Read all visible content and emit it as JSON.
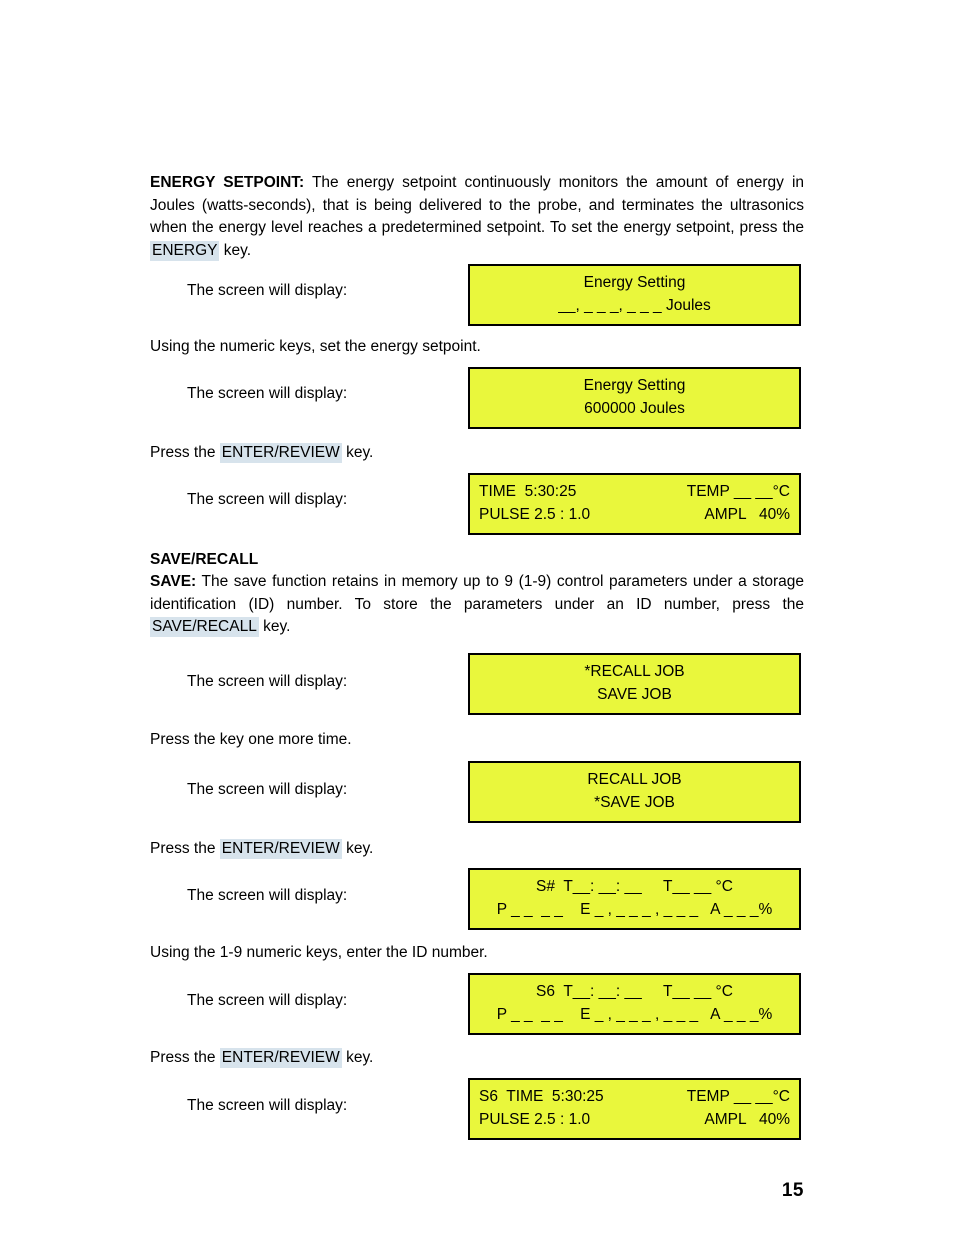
{
  "document": {
    "page_number": "15",
    "colors": {
      "lcd_background": "#e9f73c",
      "lcd_border": "#000000",
      "key_highlight": "#d7e3ec",
      "text": "#000000"
    }
  },
  "sections": {
    "energy_setpoint": {
      "heading": "ENERGY SETPOINT:",
      "body_part1": " The energy setpoint continuously monitors the amount of energy in Joules (watts-seconds), that is being delivered to the probe, and terminates the ultrasonics when the energy level reaches a predetermined setpoint. To set the energy setpoint, press the ",
      "key1": "ENERGY",
      "body_part2": " key."
    },
    "save_recall": {
      "heading": "SAVE/RECALL",
      "save_label": "SAVE:",
      "body_part1": " The save function retains in memory up to 9 (1-9) control parameters under a storage identification (ID) number. To store the parameters under an ID number, press the ",
      "key1": "SAVE/RECALL",
      "body_part2": " key."
    }
  },
  "instructions": {
    "screen_will_display": "The screen will display:",
    "set_energy_setpoint": "Using the numeric keys, set the energy setpoint.",
    "press_the": "Press the ",
    "key_enter_review": "ENTER/REVIEW",
    "key_suffix": " key.",
    "press_key_one_more_time": "Press the key one more time.",
    "enter_id_number": "Using the 1-9 numeric keys, enter the ID number."
  },
  "displays": {
    "energy_blank": {
      "line1": "Energy Setting",
      "line2": "__, _ _ _, _ _ _ Joules"
    },
    "energy_set": {
      "line1": "Energy Setting",
      "line2": "600000 Joules"
    },
    "run_status": {
      "line1_left": "TIME  5:30:25",
      "line1_right": "TEMP __ __°C",
      "line2_left": "PULSE 2.5 : 1.0",
      "line2_right": "AMPL   40%"
    },
    "job_menu_recall": {
      "line1": "*RECALL JOB",
      "line2": "SAVE JOB"
    },
    "job_menu_save": {
      "line1": "RECALL JOB",
      "line2": "*SAVE JOB"
    },
    "id_prompt_blank": {
      "line1": "S#  T__: __: __     T__ __ °C",
      "line2": "P _ _  _ _    E _ , _ _ _ , _ _ _   A _ _ _%"
    },
    "id_prompt_s6": {
      "line1": "S6  T__: __: __     T__ __ °C",
      "line2": "P _ _  _ _    E _ , _ _ _ , _ _ _   A _ _ _%"
    },
    "run_status_s6": {
      "line1_left": "S6  TIME  5:30:25",
      "line1_right": "TEMP __ __°C",
      "line2_left": "PULSE 2.5 : 1.0",
      "line2_right": "AMPL   40%"
    }
  }
}
